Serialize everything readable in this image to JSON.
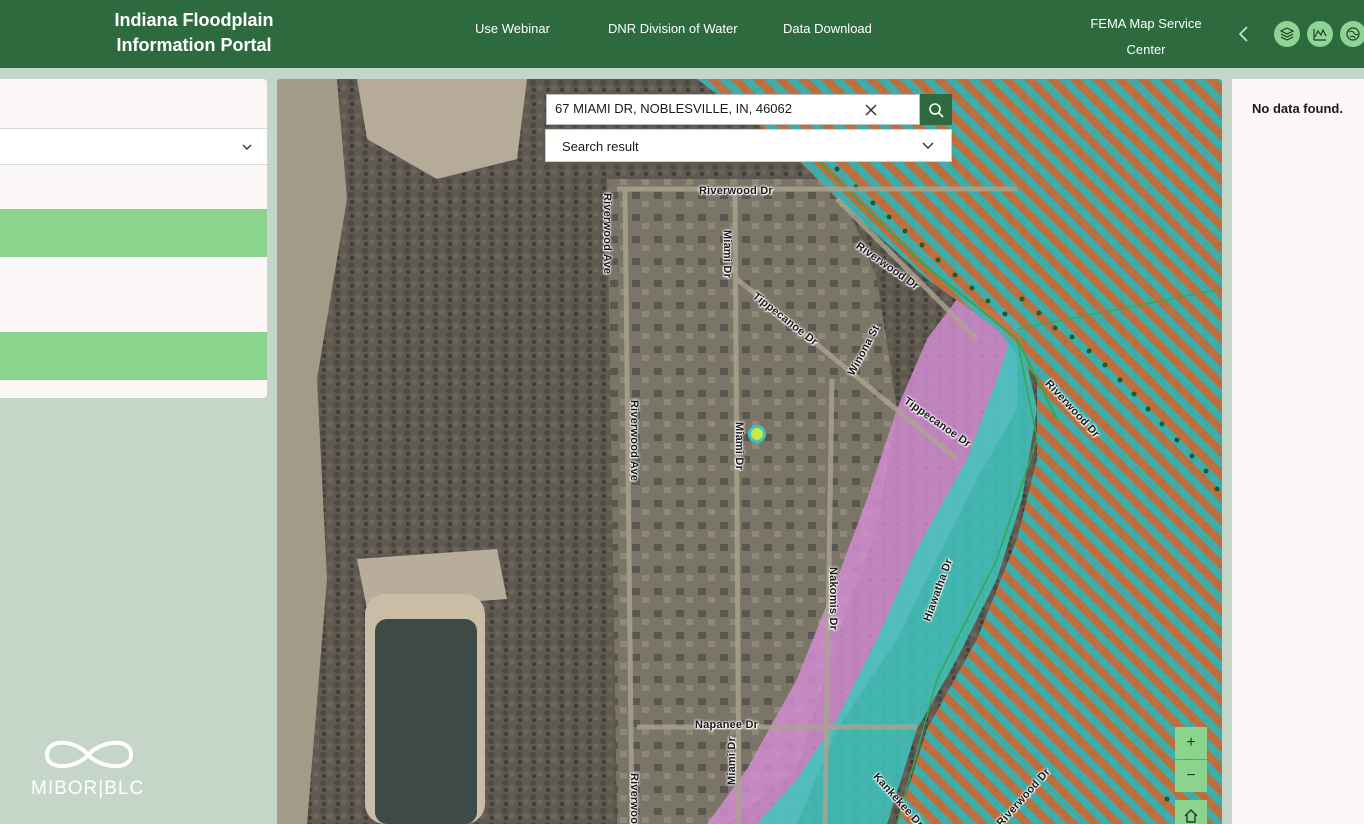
{
  "header": {
    "title_line1": "Indiana Floodplain",
    "title_line2": "Information Portal",
    "nav": [
      "Use Webinar",
      "DNR Division of Water",
      "Data Download"
    ],
    "fema_line1": "FEMA Map Service",
    "fema_line2": "Center",
    "icons": [
      "layers-icon",
      "chart-icon",
      "globe-icon"
    ]
  },
  "search": {
    "value": "67 MIAMI DR, NOBLESVILLE, IN, 46062",
    "result_label": "Search result"
  },
  "map": {
    "streets": [
      "Riverwood Dr",
      "Miami Dr",
      "Riverwood Dr",
      "Tippecanoe Dr",
      "Winona St",
      "Tippecanoe Dr",
      "Riverwood Dr",
      "Riverwood Ave",
      "Miami Dr",
      "Nakomis Dr",
      "Hiawatha Dr",
      "Napanee Dr",
      "Kankekee Dr",
      "Riverwood Dr",
      "Riverwood Ave",
      "Riverwood Ave",
      "Miami Dr"
    ],
    "zoom_in": "+",
    "zoom_out": "−"
  },
  "right_panel": {
    "message": "No data found."
  },
  "logo": {
    "text": "MIBOR|BLC"
  },
  "colors": {
    "header": "#2d6b3f",
    "accent": "#8ad48d",
    "flood_teal": "#3ec5c0",
    "flood_orange": "#d2733c",
    "flood_pink": "#d88fd8"
  }
}
